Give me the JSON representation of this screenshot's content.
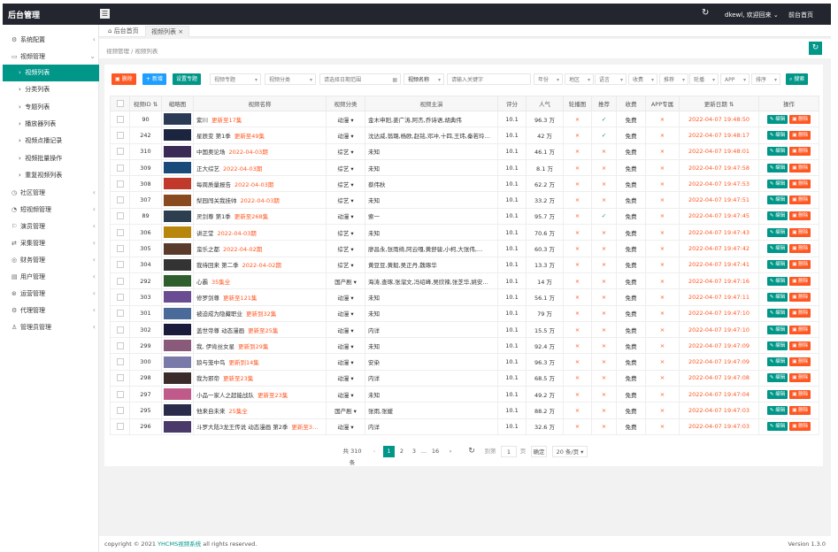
{
  "app": {
    "title": "后台管理",
    "user": "dkewl, 欢迎回来",
    "home_link": "前台首页",
    "version": "Version 1.3.0"
  },
  "icons": {
    "menu": "menu-icon",
    "refresh": "refresh-icon",
    "user_caret": "chevron-down-icon",
    "add": "plus-icon",
    "delete": "trash-icon",
    "edit": "edit-icon",
    "search": "search-icon"
  },
  "colors": {
    "accent": "#009688",
    "danger": "#ff5722",
    "topbar": "#23262e",
    "warning": "#009688"
  },
  "sidebar": {
    "items": [
      {
        "label": "系统配置",
        "ico": "⚙"
      },
      {
        "label": "视频管理",
        "ico": "▭"
      }
    ],
    "sub_items": [
      {
        "label": "视频列表",
        "active": true
      },
      {
        "label": "分类列表"
      },
      {
        "label": "专题列表"
      },
      {
        "label": "播放器列表"
      },
      {
        "label": "视频点播记录"
      },
      {
        "label": "视频批量操作"
      },
      {
        "label": "重复视频列表"
      }
    ],
    "items2": [
      {
        "label": "社区管理",
        "ico": "◷"
      },
      {
        "label": "短视频管理",
        "ico": "◔"
      },
      {
        "label": "演员管理",
        "ico": "⚐"
      },
      {
        "label": "采集管理",
        "ico": "⇄"
      },
      {
        "label": "财务管理",
        "ico": "◎"
      },
      {
        "label": "用户管理",
        "ico": "▤"
      },
      {
        "label": "运营管理",
        "ico": "⊛"
      },
      {
        "label": "代理管理",
        "ico": "⚙"
      },
      {
        "label": "管理员管理",
        "ico": "♙"
      }
    ]
  },
  "tabs": [
    {
      "label": "后台首页",
      "ico": "⌂"
    },
    {
      "label": "视频列表"
    }
  ],
  "breadcrumb": {
    "a": "视频管理",
    "sep": "/",
    "b": "视频列表"
  },
  "toolbar": {
    "delete": "删除",
    "add": "新增",
    "topic": "设置专题",
    "filters": [
      {
        "label": "视频专题",
        "type": "select"
      },
      {
        "label": "视频分类",
        "type": "select"
      },
      {
        "label": "请选择日期范围",
        "type": "date"
      },
      {
        "label": "视频名称",
        "type": "select"
      },
      {
        "label": "请输入关键字",
        "type": "input"
      },
      {
        "label": "年份",
        "type": "select"
      },
      {
        "label": "地区",
        "type": "select"
      },
      {
        "label": "语言",
        "type": "select"
      },
      {
        "label": "收费",
        "type": "select"
      },
      {
        "label": "推荐",
        "type": "select"
      },
      {
        "label": "轮播",
        "type": "select"
      },
      {
        "label": "APP",
        "type": "select"
      },
      {
        "label": "排序",
        "type": "select"
      }
    ],
    "search": "搜索"
  },
  "table": {
    "headers": [
      "",
      "视频ID",
      "缩略图",
      "视频名称",
      "视频分类",
      "视频主演",
      "评分",
      "人气",
      "轮播图",
      "推荐",
      "收费",
      "APP专属",
      "更新日期",
      "操作"
    ],
    "edit": "编辑",
    "del": "删除",
    "rows": [
      {
        "id": "90",
        "name": "紫川",
        "upd": "更新至17集",
        "cat": "动漫",
        "cast": "金木申阳,姜广涛,阿杰,乔诗语,胡典伟",
        "score": "10.1",
        "pop": "96.3 万",
        "carousel": "×",
        "rec": "✓",
        "fee": "免费",
        "app": "×",
        "date": "2022-04-07 19:48:50",
        "thumb": "#2a3a55"
      },
      {
        "id": "242",
        "name": "星辰变 第1季",
        "upd": "更新至49集",
        "cat": "动漫",
        "cast": "沈达威,翁璐,杨欧,赵铭,邓冲,十四,王玮,秦若玲…",
        "score": "10.1",
        "pop": "42 万",
        "carousel": "×",
        "rec": "✓",
        "fee": "免费",
        "app": "×",
        "date": "2022-04-07 19:48:17",
        "thumb": "#1b2540"
      },
      {
        "id": "310",
        "name": "中国奥论场",
        "upd": "2022-04-03期",
        "cat": "综艺",
        "cast": "未知",
        "score": "10.1",
        "pop": "46.1 万",
        "carousel": "×",
        "rec": "×",
        "fee": "免费",
        "app": "×",
        "date": "2022-04-07 19:48:01",
        "thumb": "#3a2a55"
      },
      {
        "id": "309",
        "name": "正大综艺",
        "upd": "2022-04-03期",
        "cat": "综艺",
        "cast": "未知",
        "score": "10.1",
        "pop": "8.1 万",
        "carousel": "×",
        "rec": "×",
        "fee": "免费",
        "app": "×",
        "date": "2022-04-07 19:47:58",
        "thumb": "#1a4a7a"
      },
      {
        "id": "308",
        "name": "每周质量报告",
        "upd": "2022-04-03期",
        "cat": "综艺",
        "cast": "蔡伟秋",
        "score": "10.1",
        "pop": "62.2 万",
        "carousel": "×",
        "rec": "×",
        "fee": "免费",
        "app": "×",
        "date": "2022-04-07 19:47:53",
        "thumb": "#c0392b"
      },
      {
        "id": "307",
        "name": "梨园闯关我挂帅",
        "upd": "2022-04-03期",
        "cat": "综艺",
        "cast": "未知",
        "score": "10.1",
        "pop": "33.2 万",
        "carousel": "×",
        "rec": "×",
        "fee": "免费",
        "app": "×",
        "date": "2022-04-07 19:47:51",
        "thumb": "#8a4a20"
      },
      {
        "id": "89",
        "name": "灵剑尊 第1季",
        "upd": "更新至268集",
        "cat": "动漫",
        "cast": "索一",
        "score": "10.1",
        "pop": "95.7 万",
        "carousel": "×",
        "rec": "✓",
        "fee": "免费",
        "app": "×",
        "date": "2022-04-07 19:47:45",
        "thumb": "#2c3e50"
      },
      {
        "id": "306",
        "name": "讲正堂",
        "upd": "2022-04-03期",
        "cat": "综艺",
        "cast": "未知",
        "score": "10.1",
        "pop": "70.6 万",
        "carousel": "×",
        "rec": "×",
        "fee": "免费",
        "app": "×",
        "date": "2022-04-07 19:47:43",
        "thumb": "#b8860b"
      },
      {
        "id": "305",
        "name": "蛮乐之都",
        "upd": "2022-04-02期",
        "cat": "综艺",
        "cast": "廖昌永,张雨绮,阿云嘎,黄舒骏,小柯,大张伟,…",
        "score": "10.1",
        "pop": "60.3 万",
        "carousel": "×",
        "rec": "×",
        "fee": "免费",
        "app": "×",
        "date": "2022-04-07 19:47:42",
        "thumb": "#5a3a2a"
      },
      {
        "id": "304",
        "name": "我待回来 第二季",
        "upd": "2022-04-02期",
        "cat": "综艺",
        "cast": "黄豆豆,黄毅,吴正丹,魏琢华",
        "score": "10.1",
        "pop": "13.3 万",
        "carousel": "×",
        "rec": "×",
        "fee": "免费",
        "app": "×",
        "date": "2022-04-07 19:47:41",
        "thumb": "#333"
      },
      {
        "id": "292",
        "name": "心霸",
        "upd": "35集全",
        "cat": "国产剧",
        "cast": "海涛,查琢,张溜文,冯绍峰,吴欣辣,张芝华,姚安…",
        "score": "10.1",
        "pop": "14 万",
        "carousel": "×",
        "rec": "×",
        "fee": "免费",
        "app": "×",
        "date": "2022-04-07 19:47:16",
        "thumb": "#2e5e2e"
      },
      {
        "id": "303",
        "name": "修罗剑尊",
        "upd": "更新至121集",
        "cat": "动漫",
        "cast": "未知",
        "score": "10.1",
        "pop": "56.1 万",
        "carousel": "×",
        "rec": "×",
        "fee": "免费",
        "app": "×",
        "date": "2022-04-07 19:47:11",
        "thumb": "#6a4c93"
      },
      {
        "id": "301",
        "name": "被迫成为隐藏职业",
        "upd": "更新到32集",
        "cat": "动漫",
        "cast": "未知",
        "score": "10.1",
        "pop": "79 万",
        "carousel": "×",
        "rec": "×",
        "fee": "免费",
        "app": "×",
        "date": "2022-04-07 19:47:10",
        "thumb": "#4a6a9a"
      },
      {
        "id": "302",
        "name": "盖世帝尊 动态漫画",
        "upd": "更新至25集",
        "cat": "动漫",
        "cast": "内详",
        "score": "10.1",
        "pop": "15.5 万",
        "carousel": "×",
        "rec": "×",
        "fee": "免费",
        "app": "×",
        "date": "2022-04-07 19:47:10",
        "thumb": "#1a1a3a"
      },
      {
        "id": "299",
        "name": "我, 伊肯丝女星",
        "upd": "更新到29集",
        "cat": "动漫",
        "cast": "未知",
        "score": "10.1",
        "pop": "92.4 万",
        "carousel": "×",
        "rec": "×",
        "fee": "免费",
        "app": "×",
        "date": "2022-04-07 19:47:09",
        "thumb": "#8a5a7a"
      },
      {
        "id": "300",
        "name": "狼与笼中鸟",
        "upd": "更新到14集",
        "cat": "动漫",
        "cast": "安染",
        "score": "10.1",
        "pop": "96.3 万",
        "carousel": "×",
        "rec": "×",
        "fee": "免费",
        "app": "×",
        "date": "2022-04-07 19:47:09",
        "thumb": "#7a7aaa"
      },
      {
        "id": "298",
        "name": "我为邪帝",
        "upd": "更新至23集",
        "cat": "动漫",
        "cast": "内详",
        "score": "10.1",
        "pop": "68.5 万",
        "carousel": "×",
        "rec": "×",
        "fee": "免费",
        "app": "×",
        "date": "2022-04-07 19:47:08",
        "thumb": "#3a2a2a"
      },
      {
        "id": "297",
        "name": "小品一家人之超能战队",
        "upd": "更新至23集",
        "cat": "动漫",
        "cast": "未知",
        "score": "10.1",
        "pop": "49.2 万",
        "carousel": "×",
        "rec": "×",
        "fee": "免费",
        "app": "×",
        "date": "2022-04-07 19:47:04",
        "thumb": "#c05a8a"
      },
      {
        "id": "295",
        "name": "他来自未来",
        "upd": "25集全",
        "cat": "国产剧",
        "cast": "张雨,张媛",
        "score": "10.1",
        "pop": "88.2 万",
        "carousel": "×",
        "rec": "×",
        "fee": "免费",
        "app": "×",
        "date": "2022-04-07 19:47:03",
        "thumb": "#2a2a4a"
      },
      {
        "id": "296",
        "name": "斗罗大陆3龙王传说 动态漫画 第2季",
        "upd": "更新至3…",
        "cat": "动漫",
        "cast": "内详",
        "score": "10.1",
        "pop": "32.6 万",
        "carousel": "×",
        "rec": "×",
        "fee": "免费",
        "app": "×",
        "date": "2022-04-07 19:47:03",
        "thumb": "#4a3a6a"
      }
    ]
  },
  "pagination": {
    "total": "共 310 条",
    "prev": "‹",
    "p1": "1",
    "p2": "2",
    "p3": "3",
    "dots": "…",
    "p16": "16",
    "next": "›",
    "goto": "到第",
    "page": "1",
    "unit": "页",
    "confirm": "确定",
    "size": "20 条/页"
  },
  "footer": {
    "copy": "copyright © 2021",
    "brand": "YHCMS视频系统",
    "rights": "all rights reserved."
  }
}
